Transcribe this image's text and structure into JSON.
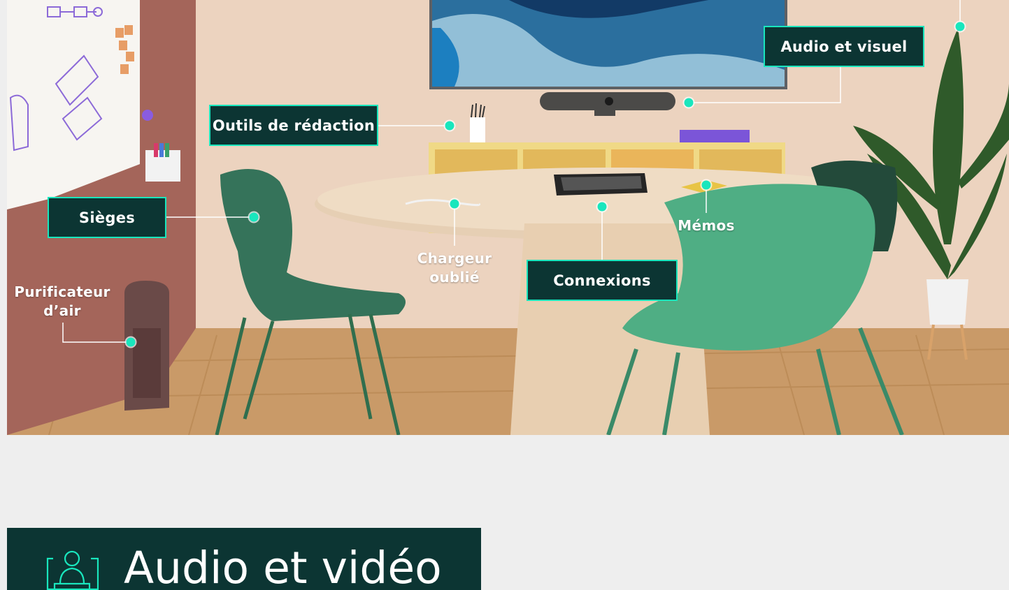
{
  "colors": {
    "accent": "#19e6bd",
    "callout_bg": "#0c3533",
    "page_bg": "#eeeeee"
  },
  "callouts": {
    "audio_visuel": "Audio et visuel",
    "outils_redaction": "Outils de rédaction",
    "sieges": "Sièges",
    "connexions": "Connexions"
  },
  "labels": {
    "purificateur_line1": "Purificateur",
    "purificateur_line2": "d’air",
    "chargeur_line1": "Chargeur",
    "chargeur_line2": "oublié",
    "memos": "Mémos"
  },
  "section": {
    "title": "Audio et vidéo",
    "icon": "user-presentation-icon"
  }
}
